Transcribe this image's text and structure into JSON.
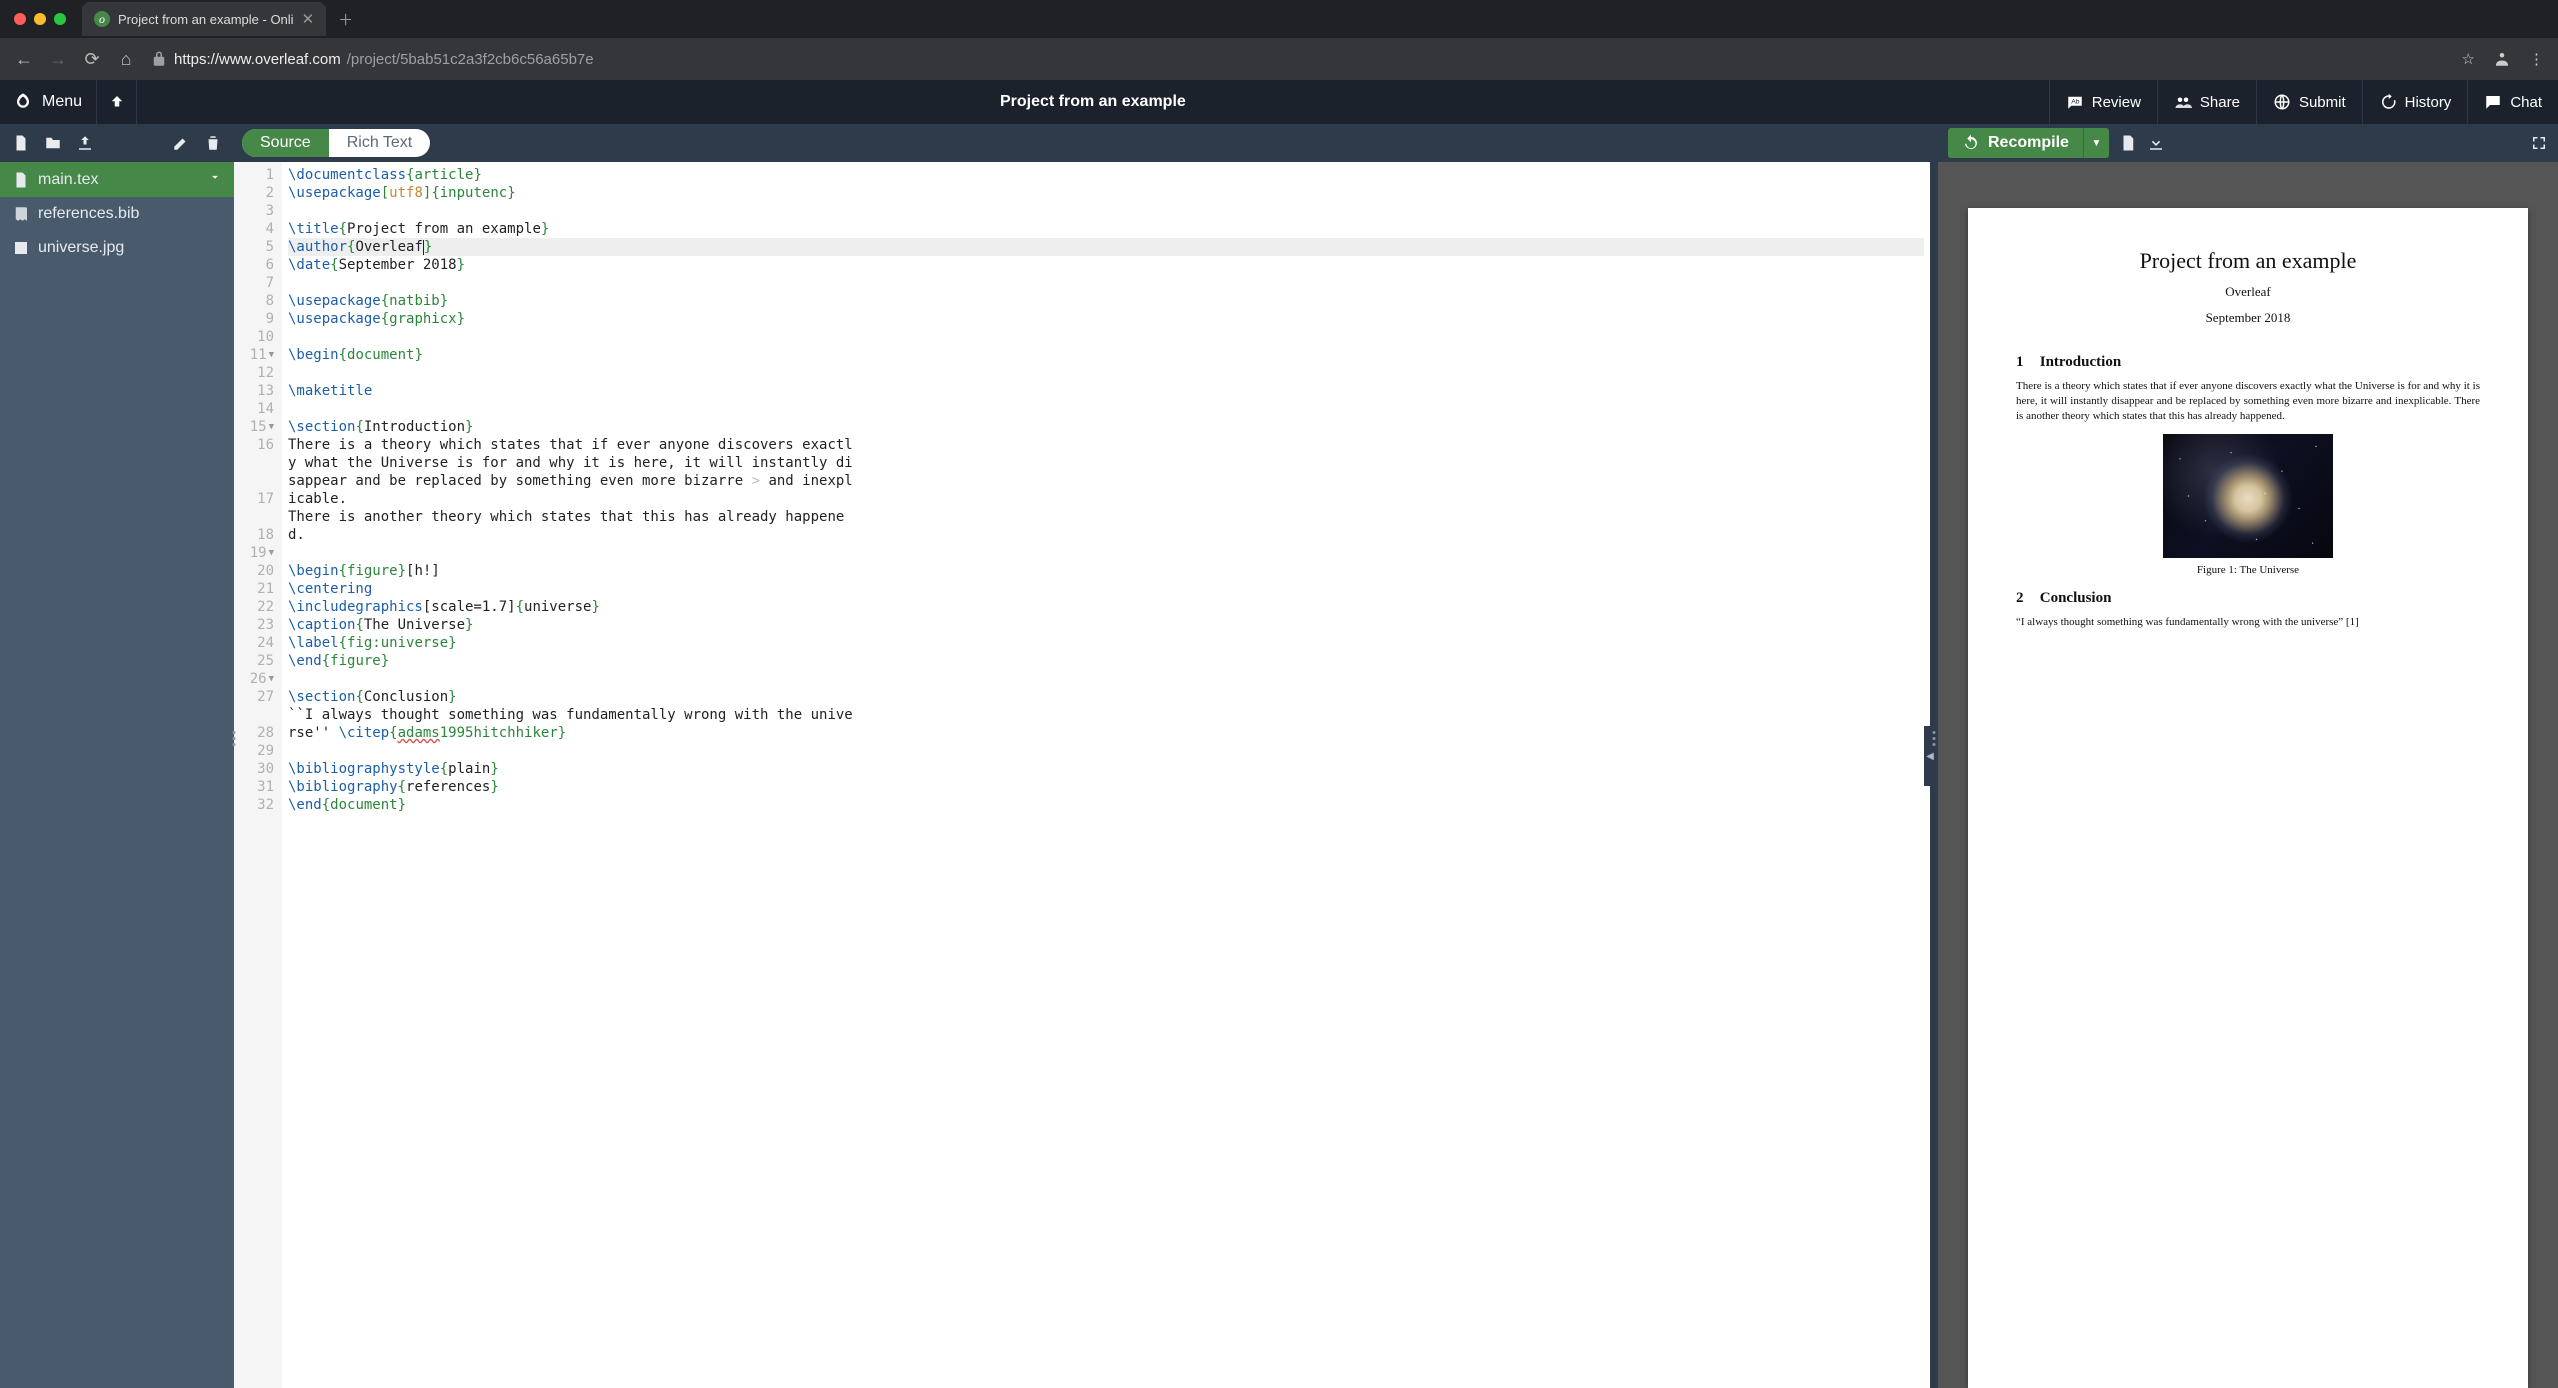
{
  "browser": {
    "tab_title": "Project from an example - Onli",
    "url_display_host": "https://www.overleaf.com",
    "url_display_path": "/project/5bab51c2a3f2cb6c56a65b7e"
  },
  "topbar": {
    "menu": "Menu",
    "project_title": "Project from an example",
    "review": "Review",
    "share": "Share",
    "submit": "Submit",
    "history": "History",
    "chat": "Chat"
  },
  "sidebar": {
    "files": [
      {
        "name": "main.tex",
        "active": true,
        "icon": "file"
      },
      {
        "name": "references.bib",
        "active": false,
        "icon": "book"
      },
      {
        "name": "universe.jpg",
        "active": false,
        "icon": "image"
      }
    ]
  },
  "editor": {
    "tab_source": "Source",
    "tab_rich": "Rich Text",
    "lines": [
      {
        "n": 1,
        "seg": [
          {
            "t": "\\documentclass",
            "c": "cmd"
          },
          {
            "t": "{",
            "c": "br"
          },
          {
            "t": "article",
            "c": "arg"
          },
          {
            "t": "}",
            "c": "br"
          }
        ]
      },
      {
        "n": 2,
        "seg": [
          {
            "t": "\\usepackage",
            "c": "cmd"
          },
          {
            "t": "[",
            "c": "br"
          },
          {
            "t": "utf8",
            "c": "opt"
          },
          {
            "t": "]",
            "c": "br"
          },
          {
            "t": "{",
            "c": "br"
          },
          {
            "t": "inputenc",
            "c": "arg"
          },
          {
            "t": "}",
            "c": "br"
          }
        ]
      },
      {
        "n": 3,
        "seg": []
      },
      {
        "n": 4,
        "seg": [
          {
            "t": "\\title",
            "c": "cmd"
          },
          {
            "t": "{",
            "c": "br"
          },
          {
            "t": "Project from an example",
            "c": ""
          },
          {
            "t": "}",
            "c": "br"
          }
        ]
      },
      {
        "n": 5,
        "hl": true,
        "seg": [
          {
            "t": "\\author",
            "c": "cmd"
          },
          {
            "t": "{",
            "c": "br"
          },
          {
            "t": "Overleaf",
            "c": ""
          },
          {
            "t": "",
            "c": "cursor"
          },
          {
            "t": "}",
            "c": "br"
          }
        ]
      },
      {
        "n": 6,
        "seg": [
          {
            "t": "\\date",
            "c": "cmd"
          },
          {
            "t": "{",
            "c": "br"
          },
          {
            "t": "September 2018",
            "c": ""
          },
          {
            "t": "}",
            "c": "br"
          }
        ]
      },
      {
        "n": 7,
        "seg": []
      },
      {
        "n": 8,
        "seg": [
          {
            "t": "\\usepackage",
            "c": "cmd"
          },
          {
            "t": "{",
            "c": "br"
          },
          {
            "t": "natbib",
            "c": "arg"
          },
          {
            "t": "}",
            "c": "br"
          }
        ]
      },
      {
        "n": 9,
        "seg": [
          {
            "t": "\\usepackage",
            "c": "cmd"
          },
          {
            "t": "{",
            "c": "br"
          },
          {
            "t": "graphicx",
            "c": "arg"
          },
          {
            "t": "}",
            "c": "br"
          }
        ]
      },
      {
        "n": 10,
        "seg": []
      },
      {
        "n": 11,
        "fold": true,
        "seg": [
          {
            "t": "\\begin",
            "c": "cmd"
          },
          {
            "t": "{",
            "c": "br"
          },
          {
            "t": "document",
            "c": "arg"
          },
          {
            "t": "}",
            "c": "br"
          }
        ]
      },
      {
        "n": 12,
        "seg": []
      },
      {
        "n": 13,
        "seg": [
          {
            "t": "\\maketitle",
            "c": "cmd"
          }
        ]
      },
      {
        "n": 14,
        "seg": []
      },
      {
        "n": 15,
        "fold": true,
        "seg": [
          {
            "t": "\\section",
            "c": "cmd"
          },
          {
            "t": "{",
            "c": "br"
          },
          {
            "t": "Introduction",
            "c": ""
          },
          {
            "t": "}",
            "c": "br"
          }
        ]
      },
      {
        "n": 16,
        "wrap": 3,
        "seg": [
          {
            "t": "There is a theory which states that if ever anyone discovers exactly what the Universe is for and why it is here, it will instantly disappear and be replaced by something even more bizarre",
            "c": ""
          },
          {
            "t": " >",
            "c": "overf"
          },
          {
            "t": " and inexplicable.",
            "c": ""
          }
        ]
      },
      {
        "n": 17,
        "wrap": 2,
        "seg": [
          {
            "t": "There is another theory which states that this has already happened.",
            "c": ""
          }
        ]
      },
      {
        "n": 18,
        "seg": []
      },
      {
        "n": 19,
        "fold": true,
        "seg": [
          {
            "t": "\\begin",
            "c": "cmd"
          },
          {
            "t": "{",
            "c": "br"
          },
          {
            "t": "figure",
            "c": "arg"
          },
          {
            "t": "}",
            "c": "br"
          },
          {
            "t": "[h!]",
            "c": ""
          }
        ]
      },
      {
        "n": 20,
        "seg": [
          {
            "t": "\\centering",
            "c": "cmd"
          }
        ]
      },
      {
        "n": 21,
        "seg": [
          {
            "t": "\\includegraphics",
            "c": "cmd"
          },
          {
            "t": "[scale=1.7]",
            "c": ""
          },
          {
            "t": "{",
            "c": "br"
          },
          {
            "t": "universe",
            "c": ""
          },
          {
            "t": "}",
            "c": "br"
          }
        ]
      },
      {
        "n": 22,
        "seg": [
          {
            "t": "\\caption",
            "c": "cmd"
          },
          {
            "t": "{",
            "c": "br"
          },
          {
            "t": "The Universe",
            "c": ""
          },
          {
            "t": "}",
            "c": "br"
          }
        ]
      },
      {
        "n": 23,
        "seg": [
          {
            "t": "\\label",
            "c": "cmd"
          },
          {
            "t": "{",
            "c": "br"
          },
          {
            "t": "fig:universe",
            "c": "label"
          },
          {
            "t": "}",
            "c": "br"
          }
        ]
      },
      {
        "n": 24,
        "seg": [
          {
            "t": "\\end",
            "c": "cmd"
          },
          {
            "t": "{",
            "c": "br"
          },
          {
            "t": "figure",
            "c": "arg"
          },
          {
            "t": "}",
            "c": "br"
          }
        ]
      },
      {
        "n": 25,
        "seg": []
      },
      {
        "n": 26,
        "fold": true,
        "seg": [
          {
            "t": "\\section",
            "c": "cmd"
          },
          {
            "t": "{",
            "c": "br"
          },
          {
            "t": "Conclusion",
            "c": ""
          },
          {
            "t": "}",
            "c": "br"
          }
        ]
      },
      {
        "n": 27,
        "wrap": 2,
        "seg": [
          {
            "t": "``I always thought something was fundamentally wrong with the universe'' ",
            "c": ""
          },
          {
            "t": "\\citep",
            "c": "cmd"
          },
          {
            "t": "{",
            "c": "br"
          },
          {
            "t": "adams",
            "c": "err"
          },
          {
            "t": "1995hitchhiker",
            "c": "label"
          },
          {
            "t": "}",
            "c": "br"
          }
        ]
      },
      {
        "n": 28,
        "seg": []
      },
      {
        "n": 29,
        "seg": [
          {
            "t": "\\bibliographystyle",
            "c": "cmd"
          },
          {
            "t": "{",
            "c": "br"
          },
          {
            "t": "plain",
            "c": ""
          },
          {
            "t": "}",
            "c": "br"
          }
        ]
      },
      {
        "n": 30,
        "seg": [
          {
            "t": "\\bibliography",
            "c": "cmd"
          },
          {
            "t": "{",
            "c": "br"
          },
          {
            "t": "references",
            "c": ""
          },
          {
            "t": "}",
            "c": "br"
          }
        ]
      },
      {
        "n": 31,
        "seg": [
          {
            "t": "\\end",
            "c": "cmd"
          },
          {
            "t": "{",
            "c": "br"
          },
          {
            "t": "document",
            "c": "arg"
          },
          {
            "t": "}",
            "c": "br"
          }
        ]
      },
      {
        "n": 32,
        "seg": []
      }
    ]
  },
  "pdf": {
    "recompile": "Recompile",
    "title": "Project from an example",
    "author": "Overleaf",
    "date": "September 2018",
    "sec1_num": "1",
    "sec1": "Introduction",
    "para1": "There is a theory which states that if ever anyone discovers exactly what the Universe is for and why it is here, it will instantly disappear and be replaced by something even more bizarre and inexplicable. There is another theory which states that this has already happened.",
    "fig_caption": "Figure 1: The Universe",
    "sec2_num": "2",
    "sec2": "Conclusion",
    "quote": "“I always thought something was fundamentally wrong with the universe”  [1]"
  }
}
